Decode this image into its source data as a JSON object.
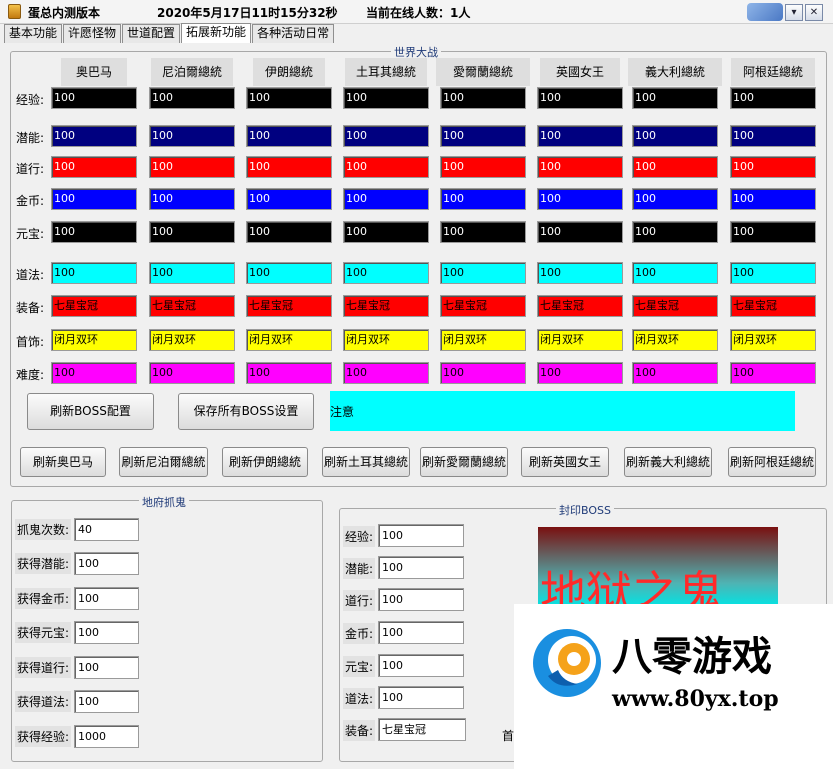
{
  "window": {
    "title": "蛋总内测版本",
    "datetime": "2020年5月17日11时15分32秒",
    "online_label": "当前在线人数：1人",
    "min_symbol": "▾"
  },
  "tabs": [
    "基本功能",
    "许愿怪物",
    "世道配置",
    "拓展新功能",
    "各种活动日常"
  ],
  "active_tab": 3,
  "world_war": {
    "legend": "世界大战",
    "columns": [
      "奥巴马",
      "尼泊爾總統",
      "伊朗總統",
      "土耳其總統",
      "愛爾蘭總統",
      "英國女王",
      "義大利總統",
      "阿根廷總統"
    ],
    "rows": [
      {
        "label": "经验:",
        "value": "100",
        "bg": "#000000",
        "fg": "#ffffff"
      },
      {
        "label": "潜能:",
        "value": "100",
        "bg": "#000080",
        "fg": "#ffffff"
      },
      {
        "label": "道行:",
        "value": "100",
        "bg": "#ff0000",
        "fg": "#ffffff"
      },
      {
        "label": "金币:",
        "value": "100",
        "bg": "#0000ff",
        "fg": "#ffffff"
      },
      {
        "label": "元宝:",
        "value": "100",
        "bg": "#000000",
        "fg": "#ffffff"
      },
      {
        "label": "道法:",
        "value": "100",
        "bg": "#00ffff",
        "fg": "#000000"
      },
      {
        "label": "装备:",
        "value": "七星宝冠",
        "bg": "#ff0000",
        "fg": "#000000"
      },
      {
        "label": "首饰:",
        "value": "闭月双环",
        "bg": "#ffff00",
        "fg": "#000000"
      },
      {
        "label": "难度:",
        "value": "100",
        "bg": "#ff00ff",
        "fg": "#000000"
      }
    ],
    "refresh_config_button": "刷新BOSS配置",
    "save_all_button": "保存所有BOSS设置",
    "notice": "注意",
    "refresh_buttons": [
      "刷新奥巴马",
      "刷新尼泊爾總統",
      "刷新伊朗總統",
      "刷新土耳其總統",
      "刷新愛爾蘭總統",
      "刷新英國女王",
      "刷新義大利總統",
      "刷新阿根廷總統"
    ]
  },
  "ghost": {
    "legend": "地府抓鬼",
    "fields": [
      {
        "label": "抓鬼次数:",
        "value": "40"
      },
      {
        "label": "获得潜能:",
        "value": "100"
      },
      {
        "label": "获得金币:",
        "value": "100"
      },
      {
        "label": "获得元宝:",
        "value": "100"
      },
      {
        "label": "获得道行:",
        "value": "100"
      },
      {
        "label": "获得道法:",
        "value": "100"
      },
      {
        "label": "获得经验:",
        "value": "1000"
      }
    ]
  },
  "seal_boss": {
    "legend": "封印BOSS",
    "fields": [
      {
        "label": "经验:",
        "value": "100"
      },
      {
        "label": "潜能:",
        "value": "100"
      },
      {
        "label": "道行:",
        "value": "100"
      },
      {
        "label": "金币:",
        "value": "100"
      },
      {
        "label": "元宝:",
        "value": "100"
      },
      {
        "label": "道法:",
        "value": "100"
      },
      {
        "label": "装备:",
        "value": "七星宝冠"
      }
    ],
    "extra_label": "首",
    "image_text": "地狱之鬼"
  },
  "watermark": {
    "brand": "八零游戏",
    "url": "www.80yx.top"
  }
}
